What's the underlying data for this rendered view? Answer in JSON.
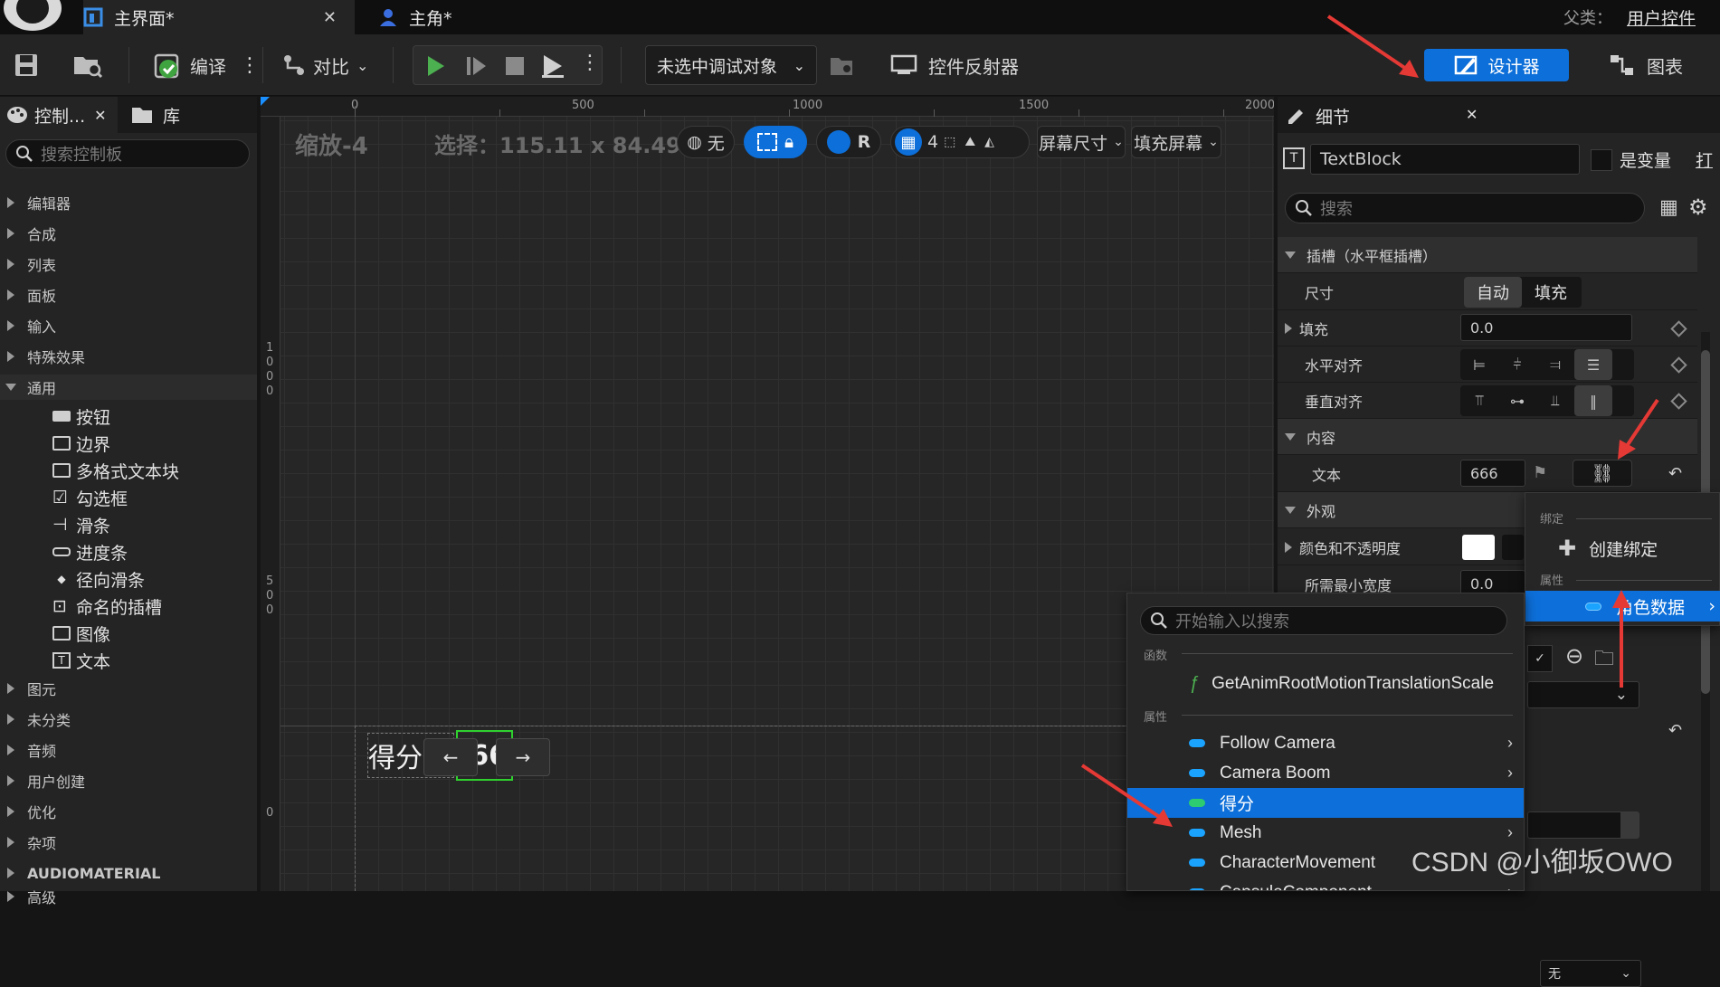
{
  "tabs": [
    {
      "label": "主界面*",
      "active": true
    },
    {
      "label": "主角*",
      "active": false
    }
  ],
  "parent_class": {
    "label": "父类：",
    "value": "用户控件"
  },
  "toolbar": {
    "compile": "编译",
    "diff": "对比",
    "debug_object": "未选中调试对象",
    "widget_reflector": "控件反射器",
    "designer": "设计器",
    "graph": "图表"
  },
  "left_panel": {
    "tab_palette": "控制...",
    "tab_library": "库",
    "search_placeholder": "搜索控制板",
    "categories_top": [
      "编辑器",
      "合成",
      "列表",
      "面板",
      "输入",
      "特殊效果",
      "通用"
    ],
    "common_items": [
      "按钮",
      "边界",
      "多格式文本块",
      "勾选框",
      "滑条",
      "进度条",
      "径向滑条",
      "命名的插槽",
      "图像",
      "文本"
    ],
    "categories_bottom": [
      "图元",
      "未分类",
      "音频",
      "用户创建",
      "优化",
      "杂项",
      "AUDIOMATERIAL",
      "高级"
    ]
  },
  "canvas": {
    "zoom": "缩放-4",
    "selection": "选择：115.11 x 84.49",
    "locale": "无",
    "r_button": "R",
    "grid_snap": "4",
    "screen_size": "屏幕尺寸",
    "fill_screen": "填充屏幕",
    "ruler_top": [
      "0",
      "500",
      "1000",
      "1500",
      "2000"
    ],
    "ruler_left": [
      "1000",
      "500",
      "0"
    ],
    "widget_label": "得分",
    "widget_value": "666",
    "nav_left": "←",
    "nav_right": "→"
  },
  "details": {
    "title": "细节",
    "widget_name": "TextBlock",
    "is_variable": "是变量",
    "open_hint": "打",
    "search_placeholder": "搜索",
    "slot_category": "插槽（水平框插槽）",
    "size_label": "尺寸",
    "size_auto": "自动",
    "size_fill": "填充",
    "padding_label": "填充",
    "padding_value": "0.0",
    "halign_label": "水平对齐",
    "valign_label": "垂直对齐",
    "content_category": "内容",
    "text_label": "文本",
    "text_value": "666",
    "appearance_category": "外观",
    "color_label": "颜色和不透明度",
    "min_width_label": "所需最小宽度",
    "min_width_value": "0.0",
    "bottom_dropdown": "无"
  },
  "bind_menu": {
    "header_bind": "绑定",
    "create_binding": "创建绑定",
    "header_property": "属性",
    "character_data": "角色数据"
  },
  "prop_menu": {
    "search_placeholder": "开始输入以搜索",
    "header_functions": "函数",
    "function_item": "GetAnimRootMotionTranslationScale",
    "header_properties": "属性",
    "items": [
      "Follow Camera",
      "Camera Boom",
      "得分",
      "Mesh",
      "CharacterMovement",
      "CapsuleComponent"
    ],
    "selected": "得分"
  },
  "watermark": "CSDN @小御坂OWO",
  "colors": {
    "accent": "#0d6fd9",
    "annotation": "#e53935",
    "play": "#4caf50"
  }
}
